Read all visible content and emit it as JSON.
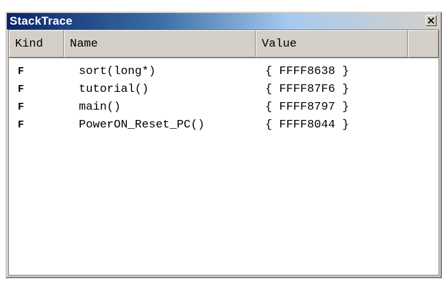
{
  "window": {
    "title": "StackTrace"
  },
  "columns": {
    "kind": "Kind",
    "name": "Name",
    "value": "Value"
  },
  "rows": [
    {
      "kind": "F",
      "name": "sort(long*)",
      "value": "{ FFFF8638 }"
    },
    {
      "kind": "F",
      "name": "tutorial()",
      "value": "{ FFFF87F6 }"
    },
    {
      "kind": "F",
      "name": "main()",
      "value": "{ FFFF8797 }"
    },
    {
      "kind": "F",
      "name": "PowerON_Reset_PC()",
      "value": "{ FFFF8044 }"
    }
  ],
  "icons": {
    "close": "close-icon"
  },
  "colors": {
    "title_start": "#0a246a",
    "title_end": "#d4d0c8",
    "face": "#d4d0c8",
    "content": "#ffffff"
  }
}
